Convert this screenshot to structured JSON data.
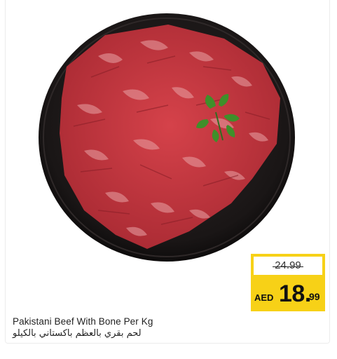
{
  "product": {
    "name_en": "Pakistani Beef With Bone Per Kg",
    "name_ar": "لحم بقري بالعظم باكستاني بالكيلو",
    "image_icon": "beef-cubes-on-plate-icon"
  },
  "price": {
    "old": "24.99",
    "currency": "AED",
    "whole": "18.",
    "cents": "99"
  },
  "colors": {
    "price_badge": "#f7d117",
    "plate": "#1e1a1a",
    "meat": "#c8343e",
    "parsley": "#3f8f2a"
  }
}
